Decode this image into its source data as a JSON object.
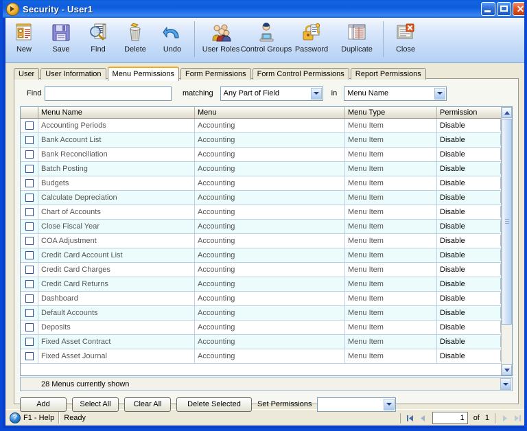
{
  "window": {
    "title": "Security - User1",
    "app_icon": "security-orb-icon",
    "controls": {
      "minimize": "minimize-button",
      "maximize": "maximize-button",
      "close": "close-button"
    }
  },
  "toolbar": {
    "groups": [
      {
        "buttons": [
          {
            "label": "New",
            "icon": "new-document-icon"
          },
          {
            "label": "Save",
            "icon": "floppy-disk-icon"
          },
          {
            "label": "Find",
            "icon": "magnifier-icon"
          },
          {
            "label": "Delete",
            "icon": "trash-can-icon"
          },
          {
            "label": "Undo",
            "icon": "undo-arrow-icon"
          }
        ]
      },
      {
        "buttons": [
          {
            "label": "User Roles",
            "icon": "users-group-icon"
          },
          {
            "label": "Control Groups",
            "icon": "user-computer-icon"
          },
          {
            "label": "Password",
            "icon": "padlock-key-icon"
          },
          {
            "label": "Duplicate",
            "icon": "duplicate-pages-icon"
          }
        ]
      },
      {
        "buttons": [
          {
            "label": "Close",
            "icon": "close-window-icon"
          }
        ]
      }
    ]
  },
  "tabs": [
    {
      "label": "User",
      "active": false
    },
    {
      "label": "User Information",
      "active": false
    },
    {
      "label": "Menu Permissions",
      "active": true
    },
    {
      "label": "Form Permissions",
      "active": false
    },
    {
      "label": "Form Control Permissions",
      "active": false
    },
    {
      "label": "Report Permissions",
      "active": false
    }
  ],
  "find": {
    "label": "Find",
    "value": "",
    "placeholder": "",
    "matching_label": "matching",
    "match_mode": "Any Part of Field",
    "in_label": "in",
    "field": "Menu Name"
  },
  "grid": {
    "columns": [
      {
        "key": "check",
        "label": ""
      },
      {
        "key": "menu_name",
        "label": "Menu Name"
      },
      {
        "key": "menu",
        "label": "Menu"
      },
      {
        "key": "menu_type",
        "label": "Menu Type"
      },
      {
        "key": "permission",
        "label": "Permission"
      }
    ],
    "rows": [
      {
        "checked": false,
        "menu_name": "Accounting Periods",
        "menu": "Accounting",
        "menu_type": "Menu Item",
        "permission": "Disable"
      },
      {
        "checked": false,
        "menu_name": "Bank Account List",
        "menu": "Accounting",
        "menu_type": "Menu Item",
        "permission": "Disable"
      },
      {
        "checked": false,
        "menu_name": "Bank Reconciliation",
        "menu": "Accounting",
        "menu_type": "Menu Item",
        "permission": "Disable"
      },
      {
        "checked": false,
        "menu_name": "Batch Posting",
        "menu": "Accounting",
        "menu_type": "Menu Item",
        "permission": "Disable"
      },
      {
        "checked": false,
        "menu_name": "Budgets",
        "menu": "Accounting",
        "menu_type": "Menu Item",
        "permission": "Disable"
      },
      {
        "checked": false,
        "menu_name": "Calculate Depreciation",
        "menu": "Accounting",
        "menu_type": "Menu Item",
        "permission": "Disable"
      },
      {
        "checked": false,
        "menu_name": "Chart of Accounts",
        "menu": "Accounting",
        "menu_type": "Menu Item",
        "permission": "Disable"
      },
      {
        "checked": false,
        "menu_name": "Close Fiscal Year",
        "menu": "Accounting",
        "menu_type": "Menu Item",
        "permission": "Disable"
      },
      {
        "checked": false,
        "menu_name": "COA Adjustment",
        "menu": "Accounting",
        "menu_type": "Menu Item",
        "permission": "Disable"
      },
      {
        "checked": false,
        "menu_name": "Credit Card Account List",
        "menu": "Accounting",
        "menu_type": "Menu Item",
        "permission": "Disable"
      },
      {
        "checked": false,
        "menu_name": "Credit Card Charges",
        "menu": "Accounting",
        "menu_type": "Menu Item",
        "permission": "Disable"
      },
      {
        "checked": false,
        "menu_name": "Credit Card Returns",
        "menu": "Accounting",
        "menu_type": "Menu Item",
        "permission": "Disable"
      },
      {
        "checked": false,
        "menu_name": "Dashboard",
        "menu": "Accounting",
        "menu_type": "Menu Item",
        "permission": "Disable"
      },
      {
        "checked": false,
        "menu_name": "Default Accounts",
        "menu": "Accounting",
        "menu_type": "Menu Item",
        "permission": "Disable"
      },
      {
        "checked": false,
        "menu_name": "Deposits",
        "menu": "Accounting",
        "menu_type": "Menu Item",
        "permission": "Disable"
      },
      {
        "checked": false,
        "menu_name": "Fixed Asset Contract",
        "menu": "Accounting",
        "menu_type": "Menu Item",
        "permission": "Disable"
      },
      {
        "checked": false,
        "menu_name": "Fixed Asset Journal",
        "menu": "Accounting",
        "menu_type": "Menu Item",
        "permission": "Disable"
      }
    ],
    "status_text": "28 Menus currently shown"
  },
  "actions": {
    "add": "Add",
    "select_all": "Select All",
    "clear_all": "Clear All",
    "delete_selected": "Delete Selected",
    "set_permissions_label": "Set Permissions",
    "set_permissions_value": ""
  },
  "statusbar": {
    "help": "F1 - Help",
    "state": "Ready",
    "page_value": "1",
    "of_label": "of",
    "page_total": "1"
  },
  "colors": {
    "title_blue": "#0f5cdd",
    "accent_orange": "#f5a623",
    "face": "#ece9d8",
    "row_alt": "#ecfcfc"
  }
}
